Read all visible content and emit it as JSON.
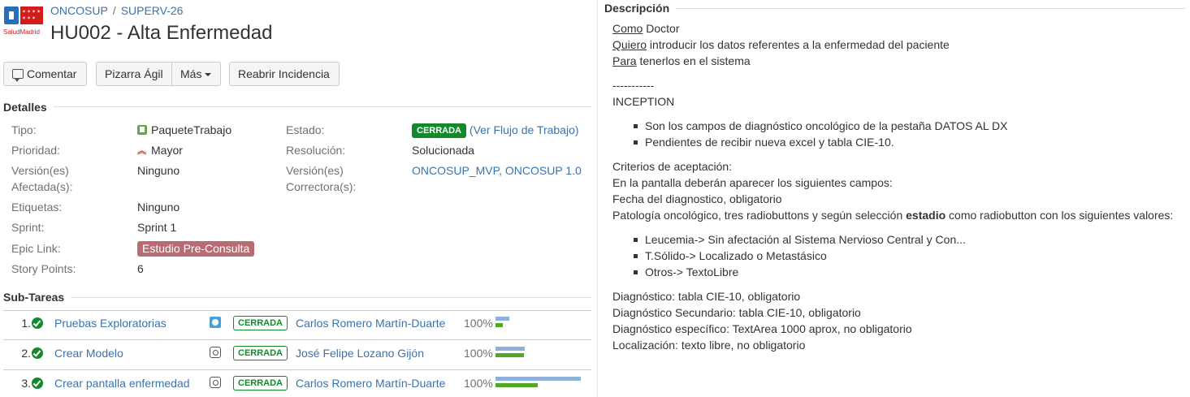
{
  "header": {
    "logo_text": "SaludMadrid",
    "breadcrumbs": [
      "ONCOSUP",
      "SUPERV-26"
    ],
    "title": "HU002 - Alta Enfermedad"
  },
  "toolbar": {
    "comment": "Comentar",
    "board": "Pizarra Ágil",
    "more": "Más",
    "reopen": "Reabrir Incidencia"
  },
  "details": {
    "heading": "Detalles",
    "type": {
      "label": "Tipo:",
      "value": "PaqueteTrabajo",
      "icon": "package-icon"
    },
    "priority": {
      "label": "Prioridad:",
      "value": "Mayor",
      "icon": "priority-major-icon"
    },
    "affects": {
      "label_line1": "Versión(es)",
      "label_line2": "Afectada(s):",
      "value": "Ninguno"
    },
    "labels": {
      "label": "Etiquetas:",
      "value": "Ninguno"
    },
    "sprint": {
      "label": "Sprint:",
      "value": "Sprint 1"
    },
    "epic": {
      "label": "Epic Link:",
      "value": "Estudio Pre-Consulta"
    },
    "points": {
      "label": "Story Points:",
      "value": "6"
    },
    "status": {
      "label": "Estado:",
      "value": "CERRADA",
      "workflow_link": "Ver Flujo de Trabajo"
    },
    "resolution": {
      "label": "Resolución:",
      "value": "Solucionada"
    },
    "fix": {
      "label_line1": "Versión(es)",
      "label_line2": "Correctora(s):",
      "value": "ONCOSUP_MVP, ONCOSUP 1.0"
    }
  },
  "subtasks": {
    "heading": "Sub-Tareas",
    "rows": [
      {
        "num": "1.",
        "name": "Pruebas Exploratorias",
        "type_icon": "blue",
        "status": "CERRADA",
        "assignee": "Carlos Romero Martín-Duarte",
        "pct": "100%",
        "estimate_fraction": 0.15,
        "logged_fraction": 0.08
      },
      {
        "num": "2.",
        "name": "Crear Modelo",
        "type_icon": "grey",
        "status": "CERRADA",
        "assignee": "José Felipe Lozano Gijón",
        "pct": "100%",
        "estimate_fraction": 0.33,
        "logged_fraction": 0.32
      },
      {
        "num": "3.",
        "name": "Crear pantalla enfermedad",
        "type_icon": "grey",
        "status": "CERRADA",
        "assignee": "Carlos Romero Martín-Duarte",
        "pct": "100%",
        "estimate_fraction": 0.95,
        "logged_fraction": 0.47
      }
    ]
  },
  "description": {
    "heading": "Descripción",
    "como_key": "Como",
    "como_rest": " Doctor",
    "quiero_key": "Quiero",
    "quiero_rest": " introducir los datos referentes a la enfermedad del paciente",
    "para_key": "Para",
    "para_rest": " tenerlos en el sistema",
    "separator": "-----------",
    "inception": "INCEPTION",
    "inception_bullets": [
      "Son los campos de diagnóstico oncológico de la pestaña DATOS AL DX",
      "Pendientes de recibir nueva excel y tabla CIE-10."
    ],
    "criteria_title": "Criterios de aceptación:",
    "criteria_intro": "En la pantalla deberán aparecer los siguientes campos:",
    "fecha": "Fecha del diagnostico, obligatorio",
    "patologia_pre": "Patología oncológico, tres radiobuttons y según selección ",
    "patologia_bold": "estadio",
    "patologia_post": " como radiobutton con los siguientes valores:",
    "patologia_bullets": [
      "Leucemia-> Sin afectación al Sistema Nervioso Central y Con...",
      "T.Sólido-> Localizado o Metastásico",
      "Otros-> TextoLibre"
    ],
    "diag": "Diagnóstico: tabla CIE-10, obligatorio",
    "diag_sec": "Diagnóstico Secundario: tabla CIE-10, obligatorio",
    "diag_esp": "Diagnóstico específico: TextArea 1000 aprox, no obligatorio",
    "localizacion": "Localización: texto libre, no obligatorio"
  }
}
